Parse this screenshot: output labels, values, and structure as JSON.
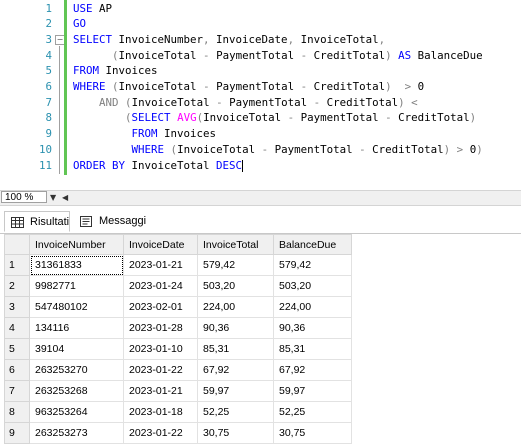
{
  "editor": {
    "lines": [
      {
        "num": "1",
        "segments": [
          {
            "t": "kw",
            "s": "USE"
          },
          {
            "t": "nm",
            "s": " AP"
          }
        ]
      },
      {
        "num": "2",
        "segments": [
          {
            "t": "kw",
            "s": "GO"
          }
        ]
      },
      {
        "num": "3",
        "segments": [
          {
            "t": "kw",
            "s": "SELECT"
          },
          {
            "t": "nm",
            "s": " InvoiceNumber"
          },
          {
            "t": "op",
            "s": ","
          },
          {
            "t": "nm",
            "s": " InvoiceDate"
          },
          {
            "t": "op",
            "s": ","
          },
          {
            "t": "nm",
            "s": " InvoiceTotal"
          },
          {
            "t": "op",
            "s": ","
          }
        ]
      },
      {
        "num": "4",
        "segments": [
          {
            "t": "nm",
            "s": "      "
          },
          {
            "t": "op",
            "s": "("
          },
          {
            "t": "nm",
            "s": "InvoiceTotal "
          },
          {
            "t": "op",
            "s": "-"
          },
          {
            "t": "nm",
            "s": " PaymentTotal "
          },
          {
            "t": "op",
            "s": "-"
          },
          {
            "t": "nm",
            "s": " CreditTotal"
          },
          {
            "t": "op",
            "s": ")"
          },
          {
            "t": "nm",
            "s": " "
          },
          {
            "t": "kw",
            "s": "AS"
          },
          {
            "t": "nm",
            "s": " BalanceDue"
          }
        ]
      },
      {
        "num": "5",
        "segments": [
          {
            "t": "kw",
            "s": "FROM"
          },
          {
            "t": "nm",
            "s": " Invoices"
          }
        ]
      },
      {
        "num": "6",
        "segments": [
          {
            "t": "kw",
            "s": "WHERE"
          },
          {
            "t": "nm",
            "s": " "
          },
          {
            "t": "op",
            "s": "("
          },
          {
            "t": "nm",
            "s": "InvoiceTotal "
          },
          {
            "t": "op",
            "s": "-"
          },
          {
            "t": "nm",
            "s": " PaymentTotal "
          },
          {
            "t": "op",
            "s": "-"
          },
          {
            "t": "nm",
            "s": " CreditTotal"
          },
          {
            "t": "op",
            "s": ")"
          },
          {
            "t": "nm",
            "s": "  "
          },
          {
            "t": "op",
            "s": ">"
          },
          {
            "t": "nm",
            "s": " 0"
          }
        ]
      },
      {
        "num": "7",
        "segments": [
          {
            "t": "nm",
            "s": "    "
          },
          {
            "t": "op",
            "s": "AND"
          },
          {
            "t": "nm",
            "s": " "
          },
          {
            "t": "op",
            "s": "("
          },
          {
            "t": "nm",
            "s": "InvoiceTotal "
          },
          {
            "t": "op",
            "s": "-"
          },
          {
            "t": "nm",
            "s": " PaymentTotal "
          },
          {
            "t": "op",
            "s": "-"
          },
          {
            "t": "nm",
            "s": " CreditTotal"
          },
          {
            "t": "op",
            "s": ")"
          },
          {
            "t": "nm",
            "s": " "
          },
          {
            "t": "op",
            "s": "<"
          }
        ]
      },
      {
        "num": "8",
        "segments": [
          {
            "t": "nm",
            "s": "        "
          },
          {
            "t": "op",
            "s": "("
          },
          {
            "t": "kw",
            "s": "SELECT"
          },
          {
            "t": "nm",
            "s": " "
          },
          {
            "t": "fn",
            "s": "AVG"
          },
          {
            "t": "op",
            "s": "("
          },
          {
            "t": "nm",
            "s": "InvoiceTotal "
          },
          {
            "t": "op",
            "s": "-"
          },
          {
            "t": "nm",
            "s": " PaymentTotal "
          },
          {
            "t": "op",
            "s": "-"
          },
          {
            "t": "nm",
            "s": " CreditTotal"
          },
          {
            "t": "op",
            "s": ")"
          }
        ]
      },
      {
        "num": "9",
        "segments": [
          {
            "t": "nm",
            "s": "         "
          },
          {
            "t": "kw",
            "s": "FROM"
          },
          {
            "t": "nm",
            "s": " Invoices"
          }
        ]
      },
      {
        "num": "10",
        "segments": [
          {
            "t": "nm",
            "s": "         "
          },
          {
            "t": "kw",
            "s": "WHERE"
          },
          {
            "t": "nm",
            "s": " "
          },
          {
            "t": "op",
            "s": "("
          },
          {
            "t": "nm",
            "s": "InvoiceTotal "
          },
          {
            "t": "op",
            "s": "-"
          },
          {
            "t": "nm",
            "s": " PaymentTotal "
          },
          {
            "t": "op",
            "s": "-"
          },
          {
            "t": "nm",
            "s": " CreditTotal"
          },
          {
            "t": "op",
            "s": ")"
          },
          {
            "t": "nm",
            "s": " "
          },
          {
            "t": "op",
            "s": ">"
          },
          {
            "t": "nm",
            "s": " 0"
          },
          {
            "t": "op",
            "s": ")"
          }
        ]
      },
      {
        "num": "11",
        "segments": [
          {
            "t": "kw",
            "s": "ORDER BY"
          },
          {
            "t": "nm",
            "s": " InvoiceTotal "
          },
          {
            "t": "kw",
            "s": "DESC"
          }
        ]
      }
    ],
    "colors": {
      "keyword": "#0000ff",
      "function": "#ff00ff",
      "operator": "#808080",
      "line_number": "#2b91af",
      "change_bar": "#61c554"
    }
  },
  "statusbar": {
    "zoom_value": "100 %"
  },
  "tabs": [
    {
      "label": "Risultati",
      "icon": "grid-icon",
      "active": true
    },
    {
      "label": "Messaggi",
      "icon": "messages-icon",
      "active": false
    }
  ],
  "results": {
    "columns": [
      "InvoiceNumber",
      "InvoiceDate",
      "InvoiceTotal",
      "BalanceDue"
    ],
    "rows": [
      {
        "n": "1",
        "cells": [
          "31361833",
          "2023-01-21",
          "579,42",
          "579,42"
        ]
      },
      {
        "n": "2",
        "cells": [
          "9982771",
          "2023-01-24",
          "503,20",
          "503,20"
        ]
      },
      {
        "n": "3",
        "cells": [
          "547480102",
          "2023-02-01",
          "224,00",
          "224,00"
        ]
      },
      {
        "n": "4",
        "cells": [
          "134116",
          "2023-01-28",
          "90,36",
          "90,36"
        ]
      },
      {
        "n": "5",
        "cells": [
          "39104",
          "2023-01-10",
          "85,31",
          "85,31"
        ]
      },
      {
        "n": "6",
        "cells": [
          "263253270",
          "2023-01-22",
          "67,92",
          "67,92"
        ]
      },
      {
        "n": "7",
        "cells": [
          "263253268",
          "2023-01-21",
          "59,97",
          "59,97"
        ]
      },
      {
        "n": "8",
        "cells": [
          "963253264",
          "2023-01-18",
          "52,25",
          "52,25"
        ]
      },
      {
        "n": "9",
        "cells": [
          "263253273",
          "2023-01-22",
          "30,75",
          "30,75"
        ]
      }
    ]
  }
}
